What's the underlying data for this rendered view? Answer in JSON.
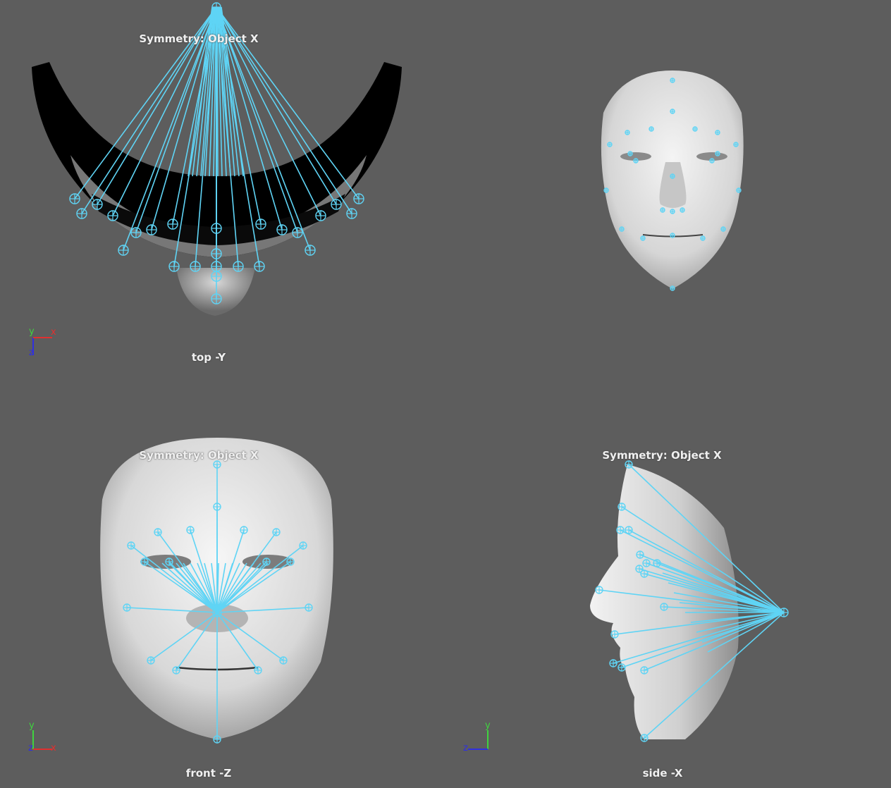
{
  "colors": {
    "background": "#5d5d5d",
    "joint": "#5fd4f5",
    "axis_x": "#e03030",
    "axis_y": "#3fd43f",
    "axis_z": "#3030e0"
  },
  "viewports": {
    "top": {
      "symmetry": "Symmetry: Object X",
      "label": "top -Y",
      "axes": {
        "a": "y",
        "b": "x",
        "c": "z"
      }
    },
    "persp": {
      "symmetry": "",
      "label": ""
    },
    "front": {
      "symmetry": "Symmetry: Object X",
      "label": "front -Z",
      "axes": {
        "a": "y",
        "b": "z",
        "c": "x"
      }
    },
    "side": {
      "symmetry": "Symmetry: Object X",
      "label": "side -X",
      "axes": {
        "a": "y",
        "b": "z"
      }
    }
  }
}
